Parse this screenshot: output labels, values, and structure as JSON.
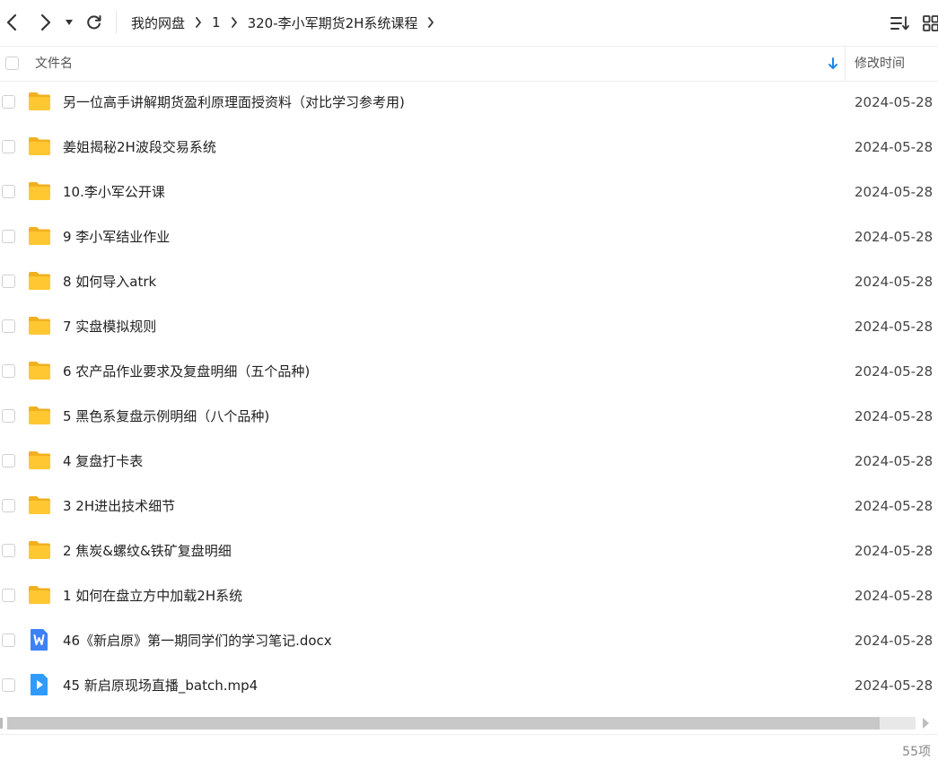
{
  "breadcrumb": [
    {
      "label": "我的网盘"
    },
    {
      "label": "1"
    },
    {
      "label": "320-李小军期货2H系统课程"
    }
  ],
  "header": {
    "name_label": "文件名",
    "date_label": "修改时间"
  },
  "colors": {
    "folder": "#FFC832",
    "folder_back": "#F2B01E",
    "word_icon": "#3C82F6",
    "video_icon": "#2F9BFF",
    "sort_arrow": "#1E88E5"
  },
  "files": [
    {
      "name": "另一位高手讲解期货盈利原理面授资料（对比学习参考用)",
      "date": "2024-05-28",
      "icon": "folder-icon"
    },
    {
      "name": "姜姐揭秘2H波段交易系统",
      "date": "2024-05-28",
      "icon": "folder-icon"
    },
    {
      "name": "10.李小军公开课",
      "date": "2024-05-28",
      "icon": "folder-icon"
    },
    {
      "name": "9 李小军结业作业",
      "date": "2024-05-28",
      "icon": "folder-icon"
    },
    {
      "name": "8 如何导入atrk",
      "date": "2024-05-28",
      "icon": "folder-icon"
    },
    {
      "name": "7 实盘模拟规则",
      "date": "2024-05-28",
      "icon": "folder-icon"
    },
    {
      "name": "6 农产品作业要求及复盘明细（五个品种)",
      "date": "2024-05-28",
      "icon": "folder-icon"
    },
    {
      "name": "5 黑色系复盘示例明细（八个品种)",
      "date": "2024-05-28",
      "icon": "folder-icon"
    },
    {
      "name": "4 复盘打卡表",
      "date": "2024-05-28",
      "icon": "folder-icon"
    },
    {
      "name": "3 2H进出技术细节",
      "date": "2024-05-28",
      "icon": "folder-icon"
    },
    {
      "name": "2 焦炭&螺纹&铁矿复盘明细",
      "date": "2024-05-28",
      "icon": "folder-icon"
    },
    {
      "name": "1 如何在盘立方中加载2H系统",
      "date": "2024-05-28",
      "icon": "folder-icon"
    },
    {
      "name": "46《新启原》第一期同学们的学习笔记.docx",
      "date": "2024-05-28",
      "icon": "word-doc-icon"
    },
    {
      "name": "45 新启原现场直播_batch.mp4",
      "date": "2024-05-28",
      "icon": "video-file-icon"
    }
  ],
  "footer": {
    "count_label": "55项"
  },
  "scroll": {
    "horizontal_position_fraction": 0.96
  }
}
